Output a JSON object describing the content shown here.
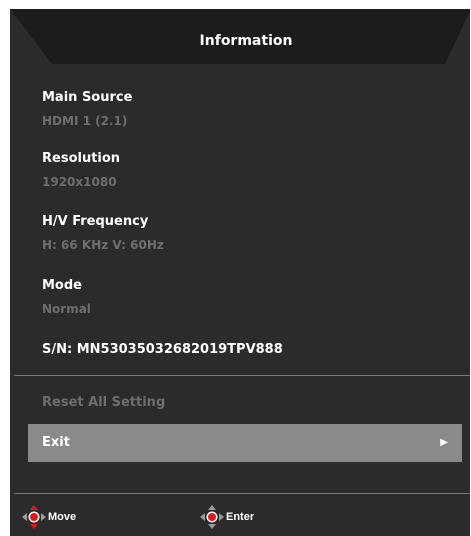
{
  "header": {
    "title": "Information"
  },
  "info": {
    "main_source": {
      "label": "Main Source",
      "value": "HDMI 1 (2.1)"
    },
    "resolution": {
      "label": "Resolution",
      "value": "1920x1080"
    },
    "frequency": {
      "label": "H/V Frequency",
      "value": "H: 66 KHz  V: 60Hz"
    },
    "mode": {
      "label": "Mode",
      "value": "Normal"
    },
    "serial": {
      "label": "S/N: MN53035032682019TPV888"
    }
  },
  "menu": {
    "reset": {
      "label": "Reset All Setting",
      "state": "disabled"
    },
    "exit": {
      "label": "Exit",
      "state": "selected",
      "arrow": "▶"
    }
  },
  "footer": {
    "move": {
      "label": "Move",
      "icon": "four-way-navigation-icon"
    },
    "enter": {
      "label": "Enter",
      "icon": "four-way-enter-icon"
    }
  },
  "colors": {
    "panel": "#2b2b2b",
    "header": "#1c1c1c",
    "value_text": "#6e6e6e",
    "selected_bg": "#8a8a8a",
    "accent_red": "#e01818"
  }
}
